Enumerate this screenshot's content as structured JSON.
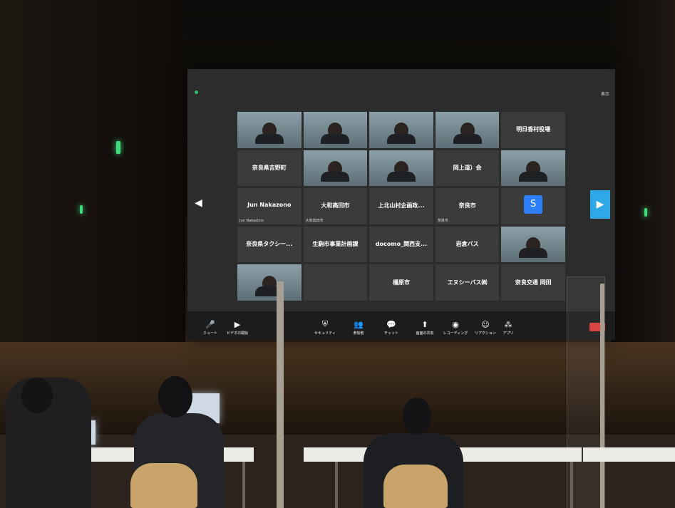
{
  "meeting": {
    "view_label": "表示",
    "tiles": [
      {
        "type": "video",
        "sub": ""
      },
      {
        "type": "video",
        "sub": ""
      },
      {
        "type": "video",
        "sub": ""
      },
      {
        "type": "video",
        "sub": ""
      },
      {
        "type": "name",
        "name": "明日香村役場",
        "sub": ""
      },
      {
        "type": "name",
        "name": "奈良県吉野町",
        "sub": ""
      },
      {
        "type": "video",
        "sub": ""
      },
      {
        "type": "video",
        "sub": ""
      },
      {
        "type": "name",
        "name": "岡上道）会",
        "sub": ""
      },
      {
        "type": "video",
        "sub": ""
      },
      {
        "type": "name",
        "name": "Jun Nakazono",
        "sub": "Jun Nakazono"
      },
      {
        "type": "name",
        "name": "大和高田市",
        "sub": "大和高田市"
      },
      {
        "type": "name",
        "name": "上北山村企画政...",
        "sub": ""
      },
      {
        "type": "name",
        "name": "奈良市",
        "sub": "奈良市"
      },
      {
        "type": "avatar",
        "initial": "S",
        "sub": ""
      },
      {
        "type": "name",
        "name": "奈良県タクシー...",
        "sub": ""
      },
      {
        "type": "name",
        "name": "生駒市事業計画課",
        "sub": ""
      },
      {
        "type": "name",
        "name": "docomo_関西支...",
        "sub": ""
      },
      {
        "type": "name",
        "name": "岩倉バス",
        "sub": ""
      },
      {
        "type": "video",
        "sub": ""
      },
      {
        "type": "video",
        "sub": ""
      },
      {
        "type": "name",
        "name": "",
        "sub": ""
      },
      {
        "type": "name",
        "name": "橿原市",
        "sub": ""
      },
      {
        "type": "name",
        "name": "エヌシーバス㈱",
        "sub": ""
      },
      {
        "type": "name",
        "name": "奈良交通 岡田",
        "sub": ""
      }
    ],
    "toolbar": [
      {
        "icon": "mic-icon",
        "glyph": "🎤",
        "label": "ミュート"
      },
      {
        "icon": "video-icon",
        "glyph": "▶",
        "label": "ビデオの開始"
      },
      {
        "icon": "security-icon",
        "glyph": "⛨",
        "label": "セキュリティ"
      },
      {
        "icon": "participants-icon",
        "glyph": "👥",
        "label": "参加者"
      },
      {
        "icon": "chat-icon",
        "glyph": "💬",
        "label": "チャット"
      },
      {
        "icon": "share-icon",
        "glyph": "⬆",
        "label": "画面の共有"
      },
      {
        "icon": "record-icon",
        "glyph": "◉",
        "label": "レコーディング"
      },
      {
        "icon": "reaction-icon",
        "glyph": "☺",
        "label": "リアクション"
      },
      {
        "icon": "apps-icon",
        "glyph": "⁂",
        "label": "アプリ"
      }
    ]
  }
}
